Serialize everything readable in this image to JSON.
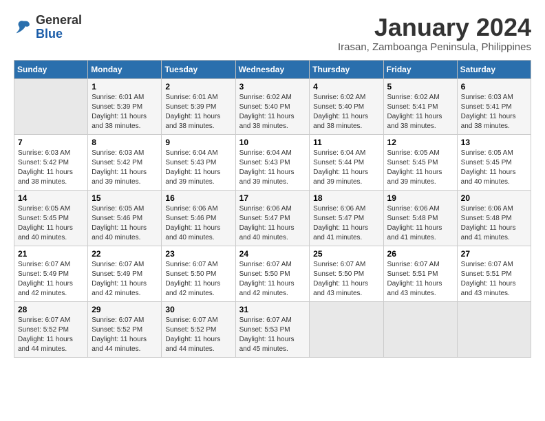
{
  "logo": {
    "line1": "General",
    "line2": "Blue"
  },
  "title": "January 2024",
  "location": "Irasan, Zamboanga Peninsula, Philippines",
  "days_header": [
    "Sunday",
    "Monday",
    "Tuesday",
    "Wednesday",
    "Thursday",
    "Friday",
    "Saturday"
  ],
  "weeks": [
    [
      {
        "day": "",
        "info": ""
      },
      {
        "day": "1",
        "info": "Sunrise: 6:01 AM\nSunset: 5:39 PM\nDaylight: 11 hours and 38 minutes."
      },
      {
        "day": "2",
        "info": "Sunrise: 6:01 AM\nSunset: 5:39 PM\nDaylight: 11 hours and 38 minutes."
      },
      {
        "day": "3",
        "info": "Sunrise: 6:02 AM\nSunset: 5:40 PM\nDaylight: 11 hours and 38 minutes."
      },
      {
        "day": "4",
        "info": "Sunrise: 6:02 AM\nSunset: 5:40 PM\nDaylight: 11 hours and 38 minutes."
      },
      {
        "day": "5",
        "info": "Sunrise: 6:02 AM\nSunset: 5:41 PM\nDaylight: 11 hours and 38 minutes."
      },
      {
        "day": "6",
        "info": "Sunrise: 6:03 AM\nSunset: 5:41 PM\nDaylight: 11 hours and 38 minutes."
      }
    ],
    [
      {
        "day": "7",
        "info": "Sunrise: 6:03 AM\nSunset: 5:42 PM\nDaylight: 11 hours and 38 minutes."
      },
      {
        "day": "8",
        "info": "Sunrise: 6:03 AM\nSunset: 5:42 PM\nDaylight: 11 hours and 39 minutes."
      },
      {
        "day": "9",
        "info": "Sunrise: 6:04 AM\nSunset: 5:43 PM\nDaylight: 11 hours and 39 minutes."
      },
      {
        "day": "10",
        "info": "Sunrise: 6:04 AM\nSunset: 5:43 PM\nDaylight: 11 hours and 39 minutes."
      },
      {
        "day": "11",
        "info": "Sunrise: 6:04 AM\nSunset: 5:44 PM\nDaylight: 11 hours and 39 minutes."
      },
      {
        "day": "12",
        "info": "Sunrise: 6:05 AM\nSunset: 5:45 PM\nDaylight: 11 hours and 39 minutes."
      },
      {
        "day": "13",
        "info": "Sunrise: 6:05 AM\nSunset: 5:45 PM\nDaylight: 11 hours and 40 minutes."
      }
    ],
    [
      {
        "day": "14",
        "info": "Sunrise: 6:05 AM\nSunset: 5:45 PM\nDaylight: 11 hours and 40 minutes."
      },
      {
        "day": "15",
        "info": "Sunrise: 6:05 AM\nSunset: 5:46 PM\nDaylight: 11 hours and 40 minutes."
      },
      {
        "day": "16",
        "info": "Sunrise: 6:06 AM\nSunset: 5:46 PM\nDaylight: 11 hours and 40 minutes."
      },
      {
        "day": "17",
        "info": "Sunrise: 6:06 AM\nSunset: 5:47 PM\nDaylight: 11 hours and 40 minutes."
      },
      {
        "day": "18",
        "info": "Sunrise: 6:06 AM\nSunset: 5:47 PM\nDaylight: 11 hours and 41 minutes."
      },
      {
        "day": "19",
        "info": "Sunrise: 6:06 AM\nSunset: 5:48 PM\nDaylight: 11 hours and 41 minutes."
      },
      {
        "day": "20",
        "info": "Sunrise: 6:06 AM\nSunset: 5:48 PM\nDaylight: 11 hours and 41 minutes."
      }
    ],
    [
      {
        "day": "21",
        "info": "Sunrise: 6:07 AM\nSunset: 5:49 PM\nDaylight: 11 hours and 42 minutes."
      },
      {
        "day": "22",
        "info": "Sunrise: 6:07 AM\nSunset: 5:49 PM\nDaylight: 11 hours and 42 minutes."
      },
      {
        "day": "23",
        "info": "Sunrise: 6:07 AM\nSunset: 5:50 PM\nDaylight: 11 hours and 42 minutes."
      },
      {
        "day": "24",
        "info": "Sunrise: 6:07 AM\nSunset: 5:50 PM\nDaylight: 11 hours and 42 minutes."
      },
      {
        "day": "25",
        "info": "Sunrise: 6:07 AM\nSunset: 5:50 PM\nDaylight: 11 hours and 43 minutes."
      },
      {
        "day": "26",
        "info": "Sunrise: 6:07 AM\nSunset: 5:51 PM\nDaylight: 11 hours and 43 minutes."
      },
      {
        "day": "27",
        "info": "Sunrise: 6:07 AM\nSunset: 5:51 PM\nDaylight: 11 hours and 43 minutes."
      }
    ],
    [
      {
        "day": "28",
        "info": "Sunrise: 6:07 AM\nSunset: 5:52 PM\nDaylight: 11 hours and 44 minutes."
      },
      {
        "day": "29",
        "info": "Sunrise: 6:07 AM\nSunset: 5:52 PM\nDaylight: 11 hours and 44 minutes."
      },
      {
        "day": "30",
        "info": "Sunrise: 6:07 AM\nSunset: 5:52 PM\nDaylight: 11 hours and 44 minutes."
      },
      {
        "day": "31",
        "info": "Sunrise: 6:07 AM\nSunset: 5:53 PM\nDaylight: 11 hours and 45 minutes."
      },
      {
        "day": "",
        "info": ""
      },
      {
        "day": "",
        "info": ""
      },
      {
        "day": "",
        "info": ""
      }
    ]
  ]
}
